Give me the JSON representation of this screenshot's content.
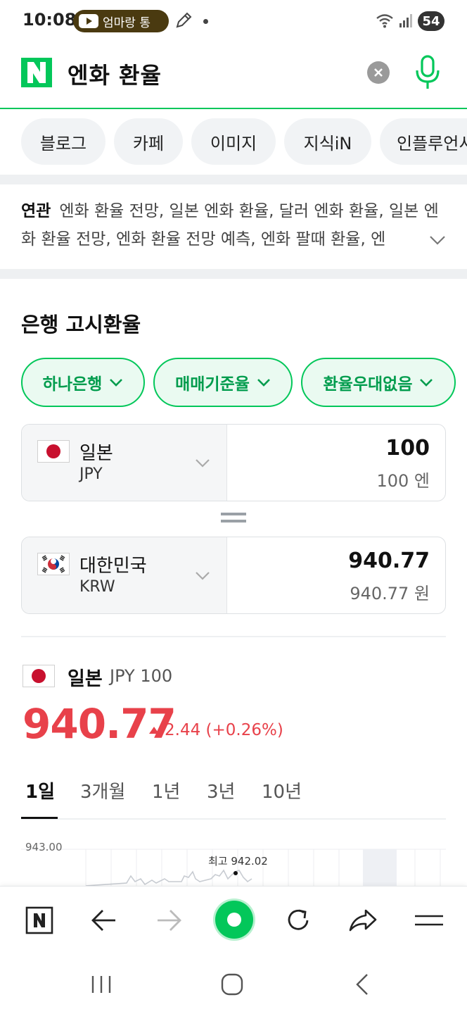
{
  "status_bar": {
    "time": "10:08",
    "media_text": "엄마랑 통",
    "battery": "54",
    "icons": [
      "youtube-icon",
      "pen-icon",
      "wifi-icon",
      "signal-icon",
      "battery-icon"
    ]
  },
  "search": {
    "logo": "N",
    "query": "엔화 환율",
    "icons": [
      "clear-icon",
      "mic-icon"
    ],
    "accent_color": "#03c75a"
  },
  "chips": [
    "블로그",
    "카페",
    "이미지",
    "지식iN",
    "인플루언서"
  ],
  "related": {
    "title": "연관",
    "text": "엔화 환율 전망, 일본 엔화 환율, 달러 엔화 환율, 일본 엔화 환율 전망, 엔화 환율 전망 예측, 엔화 팔때 환율, 엔"
  },
  "exchange": {
    "section_title": "은행 고시환율",
    "filters": [
      "하나은행",
      "매매기준율",
      "환율우대없음"
    ],
    "from": {
      "name": "일본",
      "code": "JPY",
      "amount": "100",
      "amount_label": "100 엔"
    },
    "to": {
      "name": "대한민국",
      "code": "KRW",
      "amount": "940.77",
      "amount_label": "940.77 원"
    }
  },
  "rate": {
    "country": "일본",
    "unit": "JPY 100",
    "value": "940.77",
    "change": "2.44 (+0.26%)",
    "change_color": "#e8414a",
    "periods": [
      "1일",
      "3개월",
      "1년",
      "3년",
      "10년"
    ],
    "active_period": "1일"
  },
  "chart_data": {
    "type": "line",
    "y_max_label": "943.00",
    "max_annotation": "최고 942.02",
    "series": [
      {
        "values": []
      }
    ]
  },
  "toolbar": {
    "icons": [
      "naver-n-icon",
      "back-icon",
      "forward-icon",
      "home-icon",
      "refresh-icon",
      "share-icon",
      "menu-icon"
    ]
  },
  "android_nav": {
    "icons": [
      "recents-icon",
      "home-icon",
      "back-icon"
    ]
  }
}
